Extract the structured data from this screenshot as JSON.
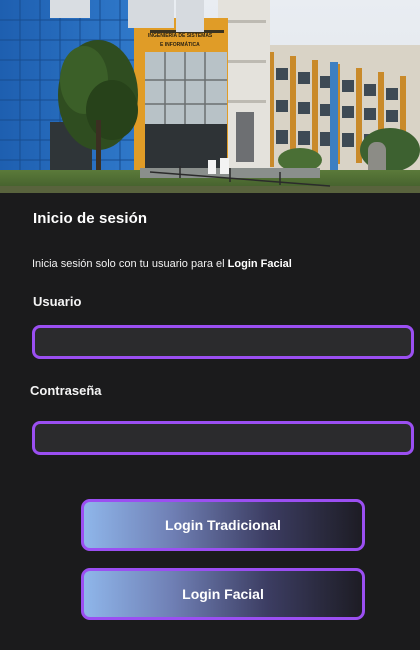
{
  "login": {
    "title": "Inicio de sesión",
    "subtitle_prefix": "Inicia sesión solo con tu usuario para el ",
    "subtitle_bold": "Login Facial",
    "username_label": "Usuario",
    "username_value": "",
    "password_label": "Contraseña",
    "password_value": "",
    "traditional_button": "Login Tradicional",
    "facial_button": "Login Facial"
  },
  "hero": {
    "sign_line1": "INGENIERÍA DE SISTEMAS",
    "sign_line2": "E INFORMÁTICA"
  },
  "colors": {
    "background": "#1b1b1c",
    "accent": "#9b4ff2",
    "field_background": "#2b2b2d"
  }
}
